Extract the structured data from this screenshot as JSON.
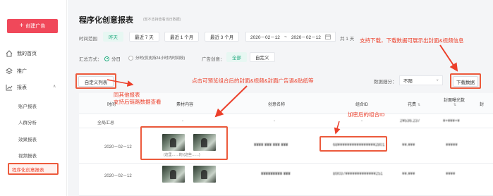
{
  "sidebar": {
    "create_label": "创建广告",
    "items": [
      {
        "label": "我的首页"
      },
      {
        "label": "推广"
      },
      {
        "label": "报表"
      }
    ],
    "report_subitems": [
      "账户报表",
      "人群分析",
      "效果报表",
      "视频报表"
    ],
    "active_item": "程序化创意报表"
  },
  "page": {
    "title": "程序化创意报表",
    "title_note": "(暂不支持查看当日数据)",
    "time_range_label": "时间范围",
    "time_chips": [
      "昨天",
      "最近 7 天",
      "最近 1 个月",
      "最近 3 个月"
    ],
    "date_start": "2020－02－12",
    "date_sep": "~",
    "date_end": "2020－02－12",
    "date_count": "共 1 天",
    "summary_label": "汇总方式：",
    "summary_options": [
      "分日",
      "分时(仅支持24小时内时间段)"
    ],
    "creative_label": "广告创意：",
    "creative_chips": [
      "全部",
      "自定义"
    ],
    "custom_columns": "自定义列表",
    "granularity_label": "数据细分：",
    "granularity_value": "不限",
    "download": "下载数据"
  },
  "annotations": {
    "download_note": "支持下载，下载数据可展示出封面&视频信息",
    "custom_note_1": "同其他报表",
    "custom_note_2": "支持后链路数据查看",
    "preview_note": "点击可预览组合后的封面&视频&封面广告语&贴纸等",
    "id_note": "加密后的组合ID"
  },
  "table": {
    "headers": [
      "时间",
      "素材内容",
      "创意名称",
      "组合ID",
      "花费",
      "封面曝光数",
      "封"
    ],
    "summary_row": {
      "time": "全局汇总",
      "material": "-",
      "name": "-",
      "id": "-",
      "cost": "2¥536.237",
      "exposure": "¥+¥¥¥+¥"
    },
    "rows": [
      {
        "time": "2020－02－12",
        "caption": "(这里……的)(这些……)",
        "name": "¥¥¥¥ ¥¥¥ ¥¥¥ ¥¥¥",
        "id": "68¥¥¥¥¥¥¥¥¥¥¥¥¥¥¥¥2801",
        "cost": "¥¥.¥¥¥",
        "exposure": "¥¥¥¥¥"
      },
      {
        "time": "2020－02－12",
        "caption": "",
        "name": "¥¥¥¥¥¥¥¥¥ ¥¥¥",
        "id": "B9037¥¥¥¥¥¥¥¥¥¥¥¥¥251",
        "cost": "¥¥.¥¥¥",
        "exposure": "¥¥¥¥"
      }
    ]
  },
  "colors": {
    "accent_red": "#f0485a",
    "annotation_red": "#ec3f2a",
    "green": "#1fa97d"
  }
}
